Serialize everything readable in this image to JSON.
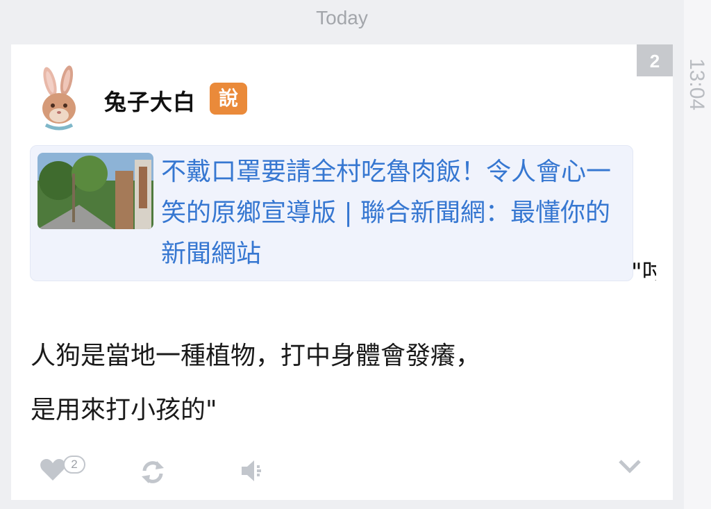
{
  "header": {
    "date_label": "Today"
  },
  "rail": {
    "time": "13:04"
  },
  "post": {
    "count_badge": "2",
    "author": "兔子大白",
    "author_tag": "說",
    "link": {
      "title": "不戴口罩要請全村吃魯肉飯！令人會心一笑的原鄉宣導版 | 聯合新聞網：最懂你的新聞網站"
    },
    "cut_text": "\"吋",
    "body_line1": "人狗是當地一種植物，打中身體會發癢，",
    "body_line2": "是用來打小孩的\"",
    "likes": "2"
  },
  "icons": {
    "avatar": "rabbit-avatar",
    "like": "heart-icon",
    "repost": "repost-icon",
    "speaker": "speaker-icon",
    "expand": "chevron-down-icon"
  },
  "colors": {
    "link": "#3677d1",
    "tag": "#ea8a3a",
    "badge": "#c7c9cd"
  }
}
